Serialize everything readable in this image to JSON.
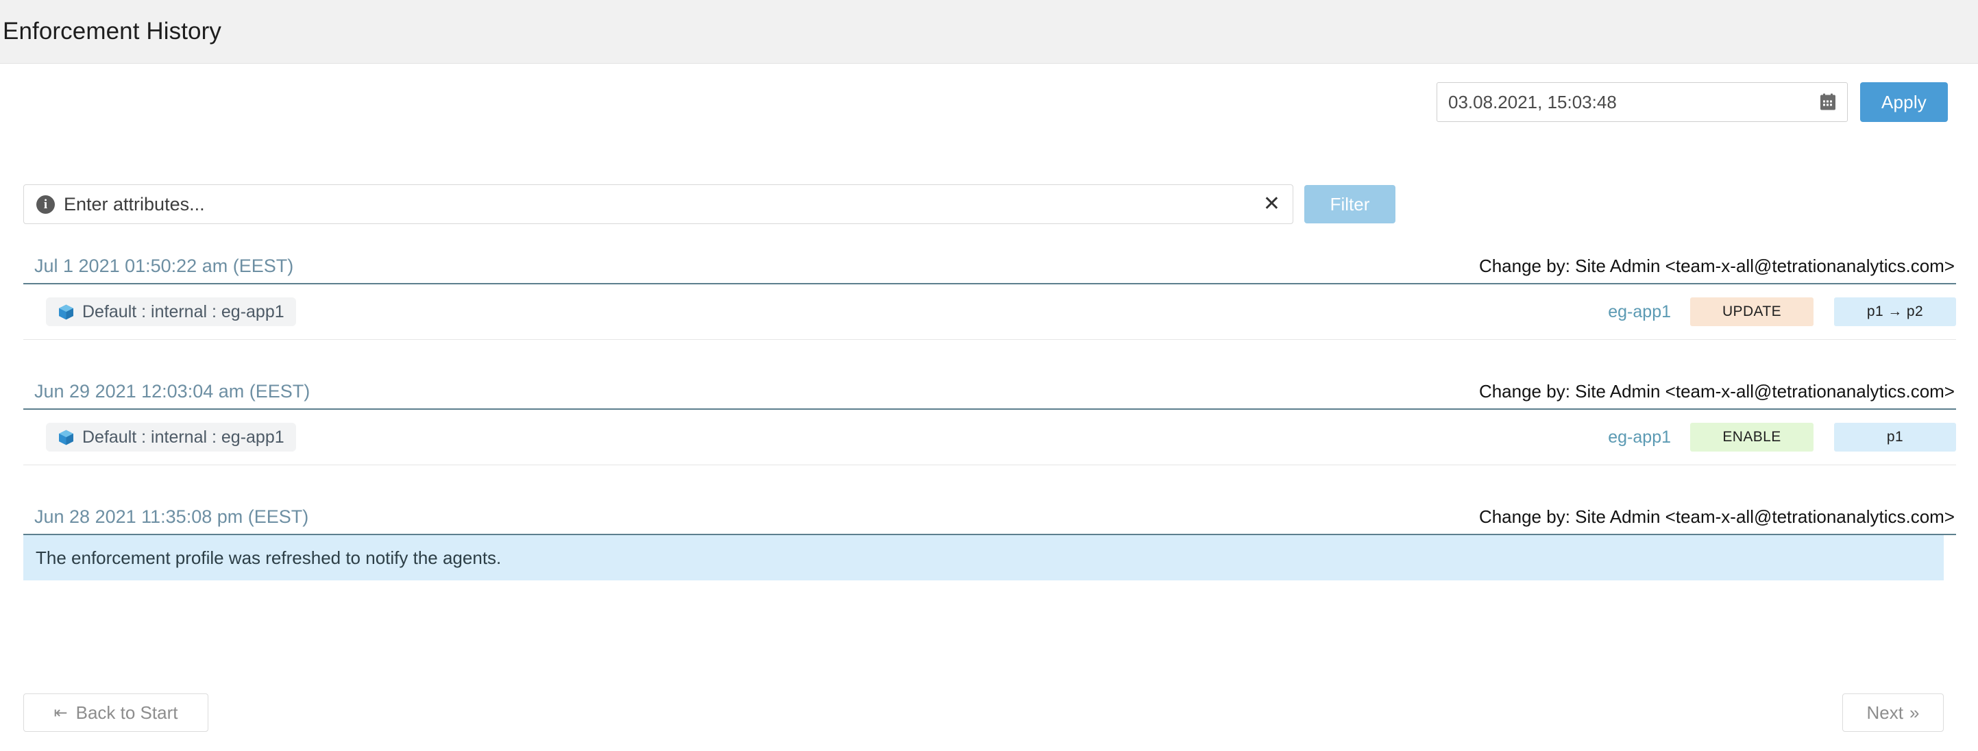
{
  "header": {
    "title": "Enforcement History"
  },
  "controls": {
    "date_value": "03.08.2021, 15:03:48",
    "calendar_icon": "calendar-icon",
    "apply_label": "Apply",
    "attributes_placeholder": "Enter attributes...",
    "info_icon": "info-icon",
    "info_glyph": "i",
    "clear_glyph": "✕",
    "filter_label": "Filter"
  },
  "colors": {
    "accent_blue": "#4a9cd6",
    "filter_disabled_blue": "#9bcbe8",
    "update_badge_bg": "#fae5d3",
    "enable_badge_bg": "#e3f7d6",
    "change_badge_bg": "#d8edfa",
    "banner_bg": "#d8edfa",
    "timestamp_blue": "#6d8fa3",
    "link_blue": "#5b9ab3",
    "header_rule": "#5c7f8e"
  },
  "entries": [
    {
      "timestamp": "Jul 1 2021 01:50:22 am (EEST)",
      "author": "Change by: Site Admin <team-x-all@tetrationanalytics.com>",
      "type": "change",
      "scope_icon": "cube-icon",
      "scope": "Default : internal : eg-app1",
      "app": "eg-app1",
      "action": "UPDATE",
      "action_bg": "#fae5d3",
      "change": "p1 → p2",
      "change_bg": "#d8edfa"
    },
    {
      "timestamp": "Jun 29 2021 12:03:04 am (EEST)",
      "author": "Change by: Site Admin <team-x-all@tetrationanalytics.com>",
      "type": "change",
      "scope_icon": "cube-icon",
      "scope": "Default : internal : eg-app1",
      "app": "eg-app1",
      "action": "ENABLE",
      "action_bg": "#e3f7d6",
      "change": "p1",
      "change_bg": "#d8edfa"
    },
    {
      "timestamp": "Jun 28 2021 11:35:08 pm (EEST)",
      "author": "Change by: Site Admin <team-x-all@tetrationanalytics.com>",
      "type": "notice",
      "notice": "The enforcement profile was refreshed to notify the agents."
    }
  ],
  "footer": {
    "back_glyph": "⇤",
    "back_label": "Back to Start",
    "next_label": "Next",
    "next_glyph": "»"
  }
}
